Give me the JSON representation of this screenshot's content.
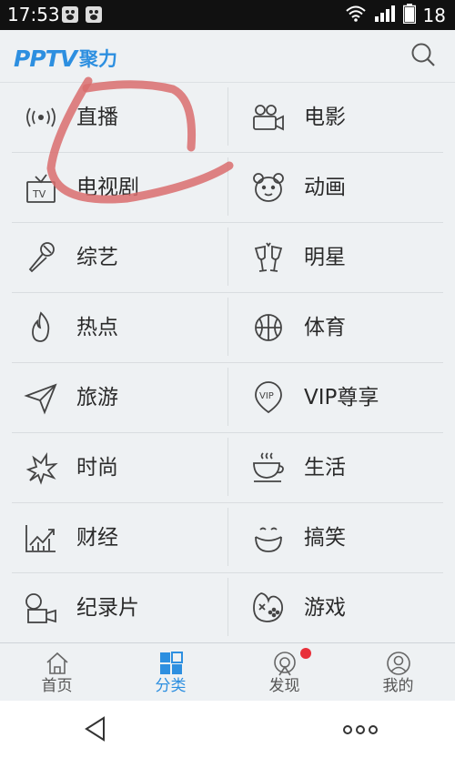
{
  "status_bar": {
    "time": "17:53",
    "notification_icons": [
      "baidu-notification-icon",
      "baidu-notification-icon"
    ],
    "wifi_icon": "wifi-icon",
    "signal_icon": "signal-icon",
    "battery_icon": "battery-icon",
    "battery_level": "18"
  },
  "header": {
    "logo_latin": "PPTV",
    "logo_cn": "聚力",
    "search_icon": "search-icon"
  },
  "categories": [
    {
      "label": "直播",
      "icon": "live-broadcast-icon"
    },
    {
      "label": "电影",
      "icon": "movie-camera-icon"
    },
    {
      "label": "电视剧",
      "icon": "tv-icon"
    },
    {
      "label": "动画",
      "icon": "bear-face-icon"
    },
    {
      "label": "综艺",
      "icon": "microphone-icon"
    },
    {
      "label": "明星",
      "icon": "champagne-toast-icon"
    },
    {
      "label": "热点",
      "icon": "flame-icon"
    },
    {
      "label": "体育",
      "icon": "basketball-icon"
    },
    {
      "label": "旅游",
      "icon": "paper-plane-icon"
    },
    {
      "label": "VIP尊享",
      "icon": "vip-badge-icon"
    },
    {
      "label": "时尚",
      "icon": "sparkle-burst-icon"
    },
    {
      "label": "生活",
      "icon": "coffee-cup-icon"
    },
    {
      "label": "财经",
      "icon": "line-chart-icon"
    },
    {
      "label": "搞笑",
      "icon": "smiley-bowl-icon"
    },
    {
      "label": "纪录片",
      "icon": "documentary-camera-icon"
    },
    {
      "label": "游戏",
      "icon": "gamepad-icon"
    }
  ],
  "tabs": [
    {
      "label": "首页",
      "icon": "home-icon",
      "active": false
    },
    {
      "label": "分类",
      "icon": "category-grid-icon",
      "active": true
    },
    {
      "label": "发现",
      "icon": "discover-icon",
      "active": false,
      "badge": true
    },
    {
      "label": "我的",
      "icon": "profile-icon",
      "active": false
    }
  ],
  "colors": {
    "accent": "#2d8fe0",
    "badge": "#e8303a",
    "annotation_stroke": "#d96d6d",
    "background": "#eef1f3"
  }
}
